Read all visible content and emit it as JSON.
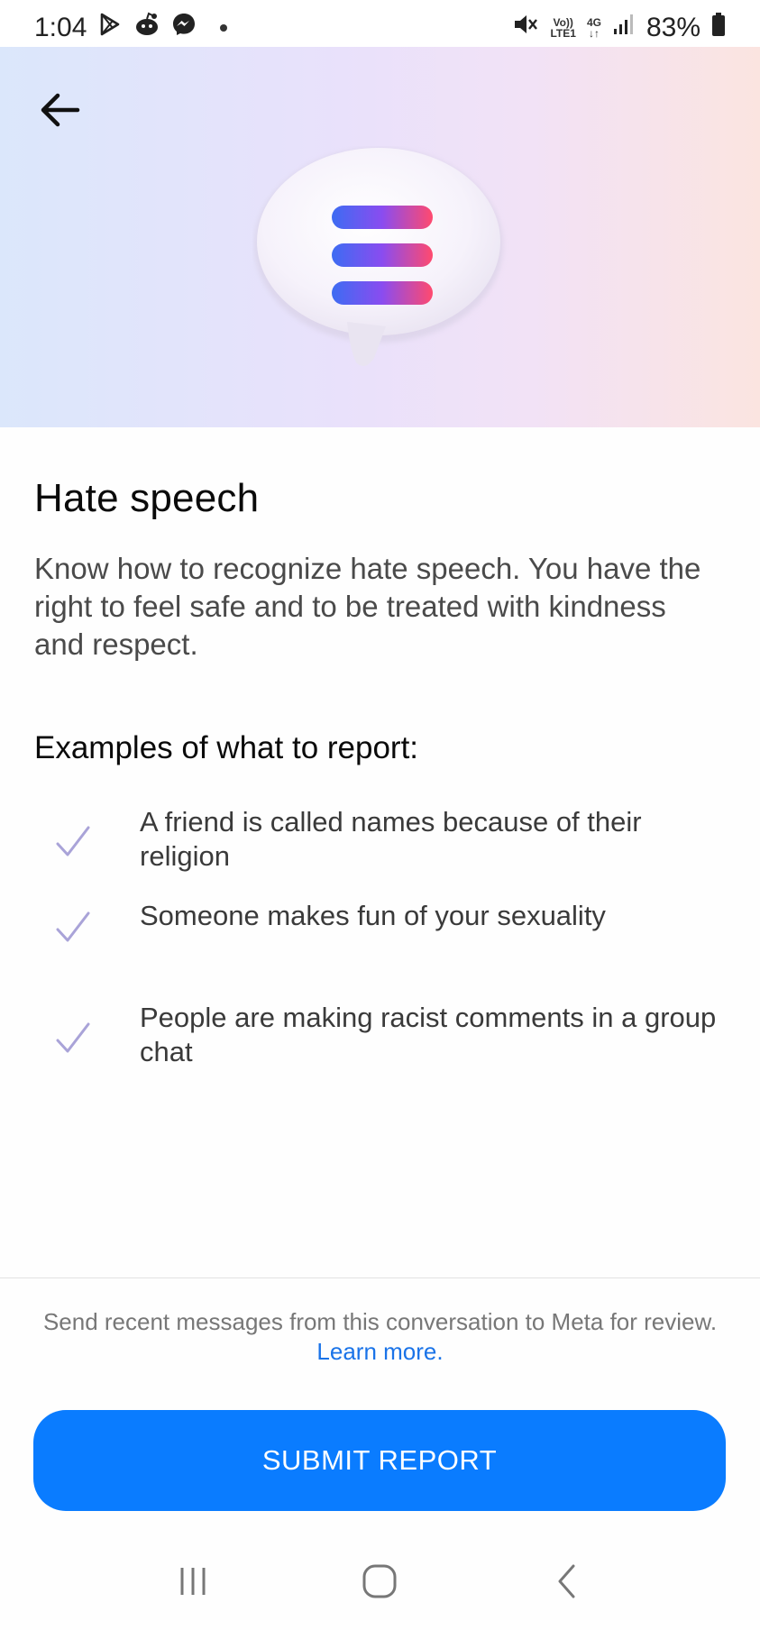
{
  "status_bar": {
    "time": "1:04",
    "network_top": "Vo))",
    "network_bottom": "LTE1",
    "network_type": "4G",
    "battery": "83%",
    "icons": [
      "play-store-icon",
      "reddit-icon",
      "messenger-icon",
      "mute-icon",
      "signal-icon",
      "battery-icon"
    ]
  },
  "hero": {
    "icon": "chat-bubble-list-icon",
    "gradient_colors": [
      "#dbe7fb",
      "#e9e1fb",
      "#f2e2f6",
      "#fbe4e0"
    ]
  },
  "content": {
    "title": "Hate speech",
    "description": "Know how to recognize hate speech. You have the right to feel safe and to be treated with kindness and respect.",
    "examples_heading": "Examples of what to report:",
    "examples": [
      "A friend is called names because of their religion",
      "Someone makes fun of your sexuality",
      "People are making racist comments in a group chat"
    ]
  },
  "footer": {
    "note": "Send recent messages from this conversation to Meta for review.",
    "learn_more": "Learn more.",
    "submit_label": "SUBMIT REPORT",
    "accent_color": "#0a7cff"
  },
  "nav": {
    "icons": [
      "recent-apps-icon",
      "home-icon",
      "back-icon"
    ]
  }
}
